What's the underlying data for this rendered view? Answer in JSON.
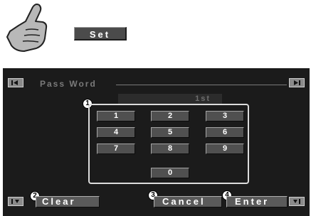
{
  "instruction": {
    "set_label": "Set"
  },
  "screen": {
    "title": "Pass Word",
    "entry_value": "1st",
    "keypad": [
      "1",
      "2",
      "3",
      "4",
      "5",
      "6",
      "7",
      "8",
      "9",
      "0"
    ],
    "buttons": {
      "clear": "Clear",
      "cancel": "Cancel",
      "enter": "Enter"
    },
    "callouts": {
      "keypad": "1",
      "clear": "2",
      "cancel": "3",
      "enter": "4"
    }
  },
  "icons": {
    "hand": "pointing-hand-icon",
    "top_left": "seek-back-icon",
    "top_right": "seek-forward-icon",
    "bottom_left": "scroll-up-icon",
    "bottom_right": "scroll-down-icon"
  }
}
